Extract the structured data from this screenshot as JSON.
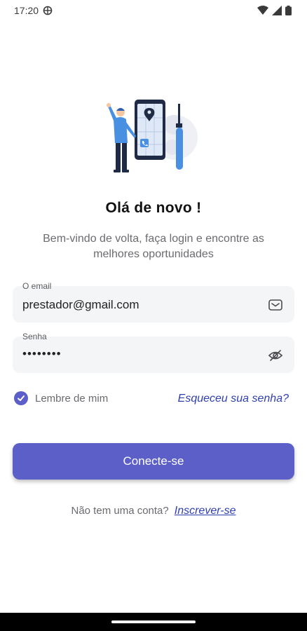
{
  "status_bar": {
    "time": "17:20"
  },
  "login": {
    "title": "Olá de novo !",
    "subtitle": "Bem-vindo de volta, faça login e encontre as melhores oportunidades",
    "email": {
      "label": "O email",
      "value": "prestador@gmail.com",
      "icon": "mail-icon"
    },
    "password": {
      "label": "Senha",
      "value": "••••••••",
      "icon": "eye-off-icon"
    },
    "remember_label": "Lembre de mim",
    "remember_checked": true,
    "forgot_label": "Esqueceu sua senha?",
    "submit_label": "Conecte-se",
    "signup_prompt": "Não tem uma conta?",
    "signup_link": "Inscrever-se"
  },
  "colors": {
    "accent": "#5b5fc7",
    "link": "#2f3fb0",
    "field_bg": "#f4f5f7"
  }
}
